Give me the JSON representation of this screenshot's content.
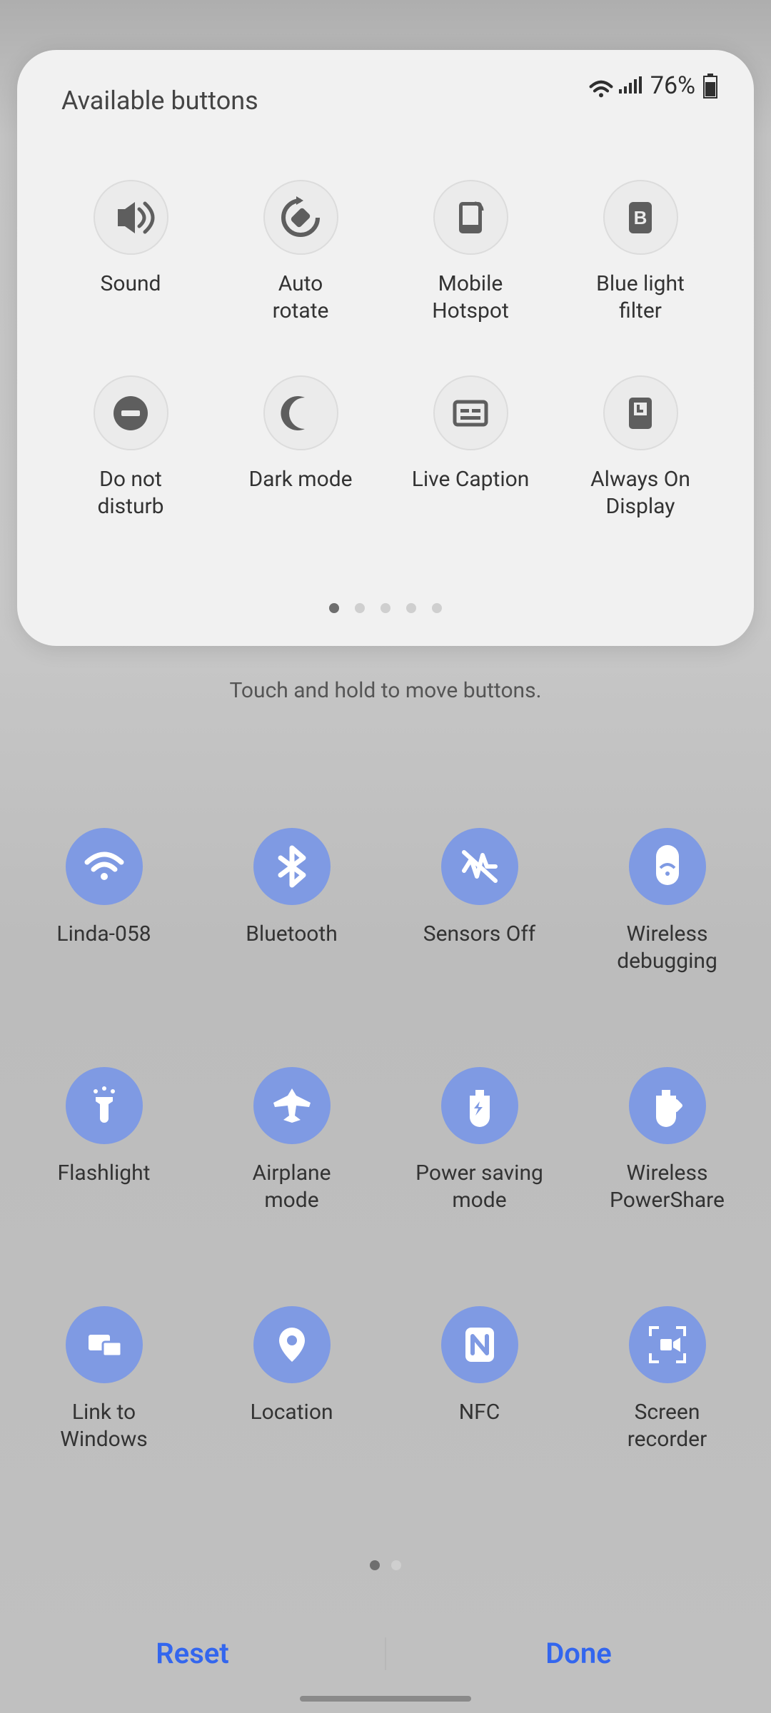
{
  "status": {
    "battery": "76%"
  },
  "panel": {
    "title": "Available buttons",
    "tiles": [
      {
        "id": "sound",
        "label": "Sound"
      },
      {
        "id": "auto-rotate",
        "label": "Auto\nrotate"
      },
      {
        "id": "hotspot",
        "label": "Mobile\nHotspot"
      },
      {
        "id": "bluelight",
        "label": "Blue light\nfilter"
      },
      {
        "id": "dnd",
        "label": "Do not\ndisturb"
      },
      {
        "id": "darkmode",
        "label": "Dark mode"
      },
      {
        "id": "livecaption",
        "label": "Live Caption"
      },
      {
        "id": "aod",
        "label": "Always On\nDisplay"
      }
    ],
    "pager": {
      "count": 5,
      "active": 0
    }
  },
  "hint": "Touch and hold to move buttons.",
  "main": {
    "tiles": [
      {
        "id": "wifi",
        "label": "Linda-058"
      },
      {
        "id": "bluetooth",
        "label": "Bluetooth"
      },
      {
        "id": "sensors",
        "label": "Sensors Off"
      },
      {
        "id": "wdebug",
        "label": "Wireless\ndebugging"
      },
      {
        "id": "flashlight",
        "label": "Flashlight"
      },
      {
        "id": "airplane",
        "label": "Airplane\nmode"
      },
      {
        "id": "powersave",
        "label": "Power saving\nmode"
      },
      {
        "id": "powershare",
        "label": "Wireless\nPowerShare"
      },
      {
        "id": "linkwin",
        "label": "Link to\nWindows"
      },
      {
        "id": "location",
        "label": "Location"
      },
      {
        "id": "nfc",
        "label": "NFC"
      },
      {
        "id": "screenrec",
        "label": "Screen\nrecorder"
      }
    ],
    "pager": {
      "count": 2,
      "active": 0
    }
  },
  "footer": {
    "reset": "Reset",
    "done": "Done"
  }
}
